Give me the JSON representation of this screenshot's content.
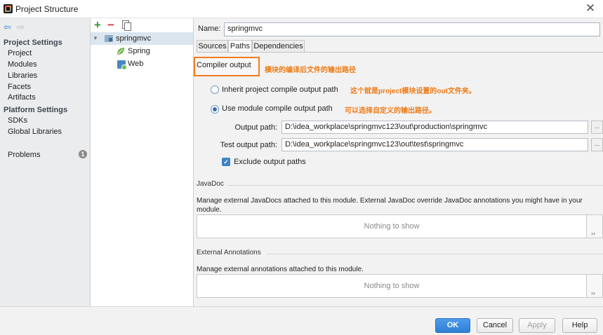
{
  "window": {
    "title": "Project Structure",
    "close_icon": "close-icon"
  },
  "nav": {
    "project_settings_header": "Project Settings",
    "project_settings_items": [
      "Project",
      "Modules",
      "Libraries",
      "Facets",
      "Artifacts"
    ],
    "platform_settings_header": "Platform Settings",
    "platform_settings_items": [
      "SDKs",
      "Global Libraries"
    ],
    "problems_label": "Problems",
    "problems_count": "1"
  },
  "tree": {
    "module": "springmvc",
    "facets": [
      "Spring",
      "Web"
    ]
  },
  "module": {
    "name_label": "Name:",
    "name_value": "springmvc",
    "tabs": [
      "Sources",
      "Paths",
      "Dependencies"
    ],
    "active_tab": "Paths"
  },
  "compiler": {
    "section_title": "Compiler output",
    "annotation_title": "模块的编译后文件的输出路径",
    "inherit_label": "Inherit project compile output path",
    "inherit_annotation": "这个就是project模块设置的out文件夹。",
    "use_module_label": "Use module compile output path",
    "use_module_annotation": "可以选择自定义的输出路径。",
    "selected_option": "use_module",
    "output_path_label": "Output path:",
    "output_path_value": "D:\\idea_workplace\\springmvc123\\out\\production\\springmvc",
    "test_output_path_label": "Test output path:",
    "test_output_path_value": "D:\\idea_workplace\\springmvc123\\out\\test\\springmvc",
    "browse_label": "...",
    "exclude_label": "Exclude output paths",
    "exclude_checked": true
  },
  "javadoc": {
    "title": "JavaDoc",
    "description": "Manage external JavaDocs attached to this module. External JavaDoc override JavaDoc annotations you might have in your module.",
    "empty_text": "Nothing to show"
  },
  "external_annotations": {
    "title": "External Annotations",
    "description": "Manage external annotations attached to this module.",
    "empty_text": "Nothing to show"
  },
  "footer": {
    "ok_label": "OK",
    "cancel_label": "Cancel",
    "apply_label": "Apply",
    "help_label": "Help"
  },
  "colors": {
    "annotation": "#ee7a14",
    "highlight_border": "#f27c1f",
    "primary_button": "#2f7fd6"
  }
}
